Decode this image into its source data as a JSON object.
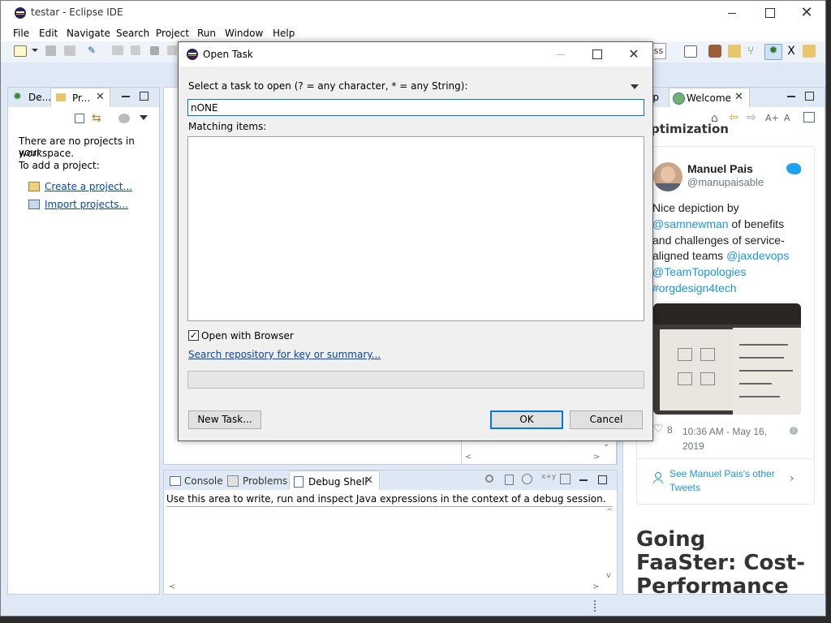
{
  "window": {
    "title": "testar - Eclipse IDE"
  },
  "menu": [
    "File",
    "Edit",
    "Navigate",
    "Search",
    "Project",
    "Run",
    "Window",
    "Help"
  ],
  "left_panel": {
    "tabs": [
      "De...",
      "Pr..."
    ],
    "msg_line1": "There are no projects in your",
    "msg_line2": "workspace.",
    "msg_line3": "To add a project:",
    "link_create": "Create a project...",
    "link_import": "Import projects..."
  },
  "right_panel": {
    "tab_prev": "lp",
    "tab_welcome": "Welcome",
    "heading_partial": "ptimization",
    "search_partial": "ess",
    "tweet": {
      "name": "Manuel Pais",
      "handle": "@manupaisable",
      "text_line1": "Nice depiction by",
      "mention1": "@samnewman",
      "text_line2_rest": " of benefits",
      "text_line3": "and challenges of service-",
      "text_line4": "aligned teams ",
      "mention2": "@jaxdevops",
      "mention3": "@TeamTopologies",
      "hashtag": "#orgdesign4tech",
      "likes": "8",
      "time_line1": "10:36 AM - May 16,",
      "time_line2": "2019",
      "see_more_line1": "See Manuel Pais's other",
      "see_more_line2": "Tweets"
    },
    "article_line1": "Going",
    "article_line2": "FaaSter: Cost-",
    "article_line3": "Performance"
  },
  "bottom_panel": {
    "tabs": [
      "Console",
      "Problems",
      "Debug Shell"
    ],
    "debug_text": "Use this area to write, run and inspect Java expressions in the context of a debug session."
  },
  "dialog": {
    "title": "Open Task",
    "prompt": "Select a task to open (? = any character, * = any String):",
    "input_value": "nONE",
    "matching_label": "Matching items:",
    "checkbox_label": "Open with Browser",
    "checkbox_checked": true,
    "search_link": "Search repository for key or summary...",
    "new_task_button": "New Task...",
    "ok_button": "OK",
    "cancel_button": "Cancel"
  },
  "colors": {
    "accent": "#0078d7",
    "link": "#0645ad",
    "twitter_blue": "#1b95e0",
    "ide_bg": "#dfe9f5"
  }
}
